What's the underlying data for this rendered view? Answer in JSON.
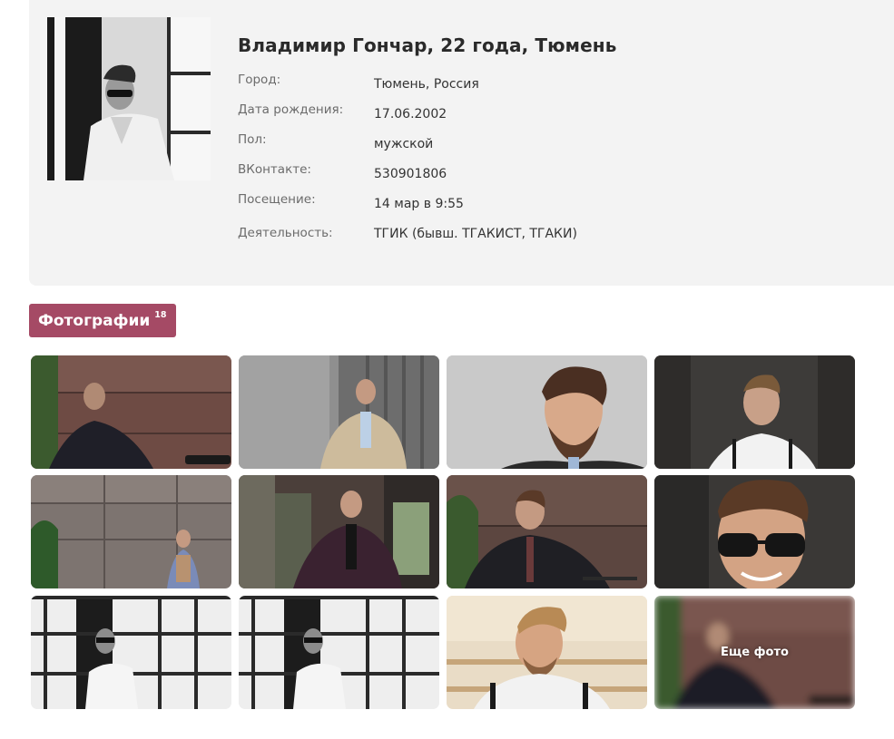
{
  "profile": {
    "name_line": "Владимир Гончар, 22 года, Тюмень",
    "avatar_icon": "profile-photo",
    "fields": [
      {
        "label": "Город:",
        "value": "Тюмень, Россия"
      },
      {
        "label": "Дата рождения:",
        "value": "17.06.2002"
      },
      {
        "label": "Пол:",
        "value": "мужской"
      },
      {
        "label": "ВКонтакте:",
        "value": "530901806"
      },
      {
        "label": "Посещение:",
        "value": "14 мар в 9:55"
      },
      {
        "label": "Деятельность:",
        "value": "ТГИК (бывш. ТГАКИСТ, ТГАКИ)"
      }
    ]
  },
  "photos": {
    "title": "Фотографии",
    "count": "18",
    "more_label": "Еще фото",
    "items_count": 12
  },
  "colors": {
    "card_background": "#f3f3f3",
    "badge_background": "#a54a65",
    "badge_text": "#ffffff",
    "label_text": "#6b6b6b",
    "value_text": "#333333"
  }
}
